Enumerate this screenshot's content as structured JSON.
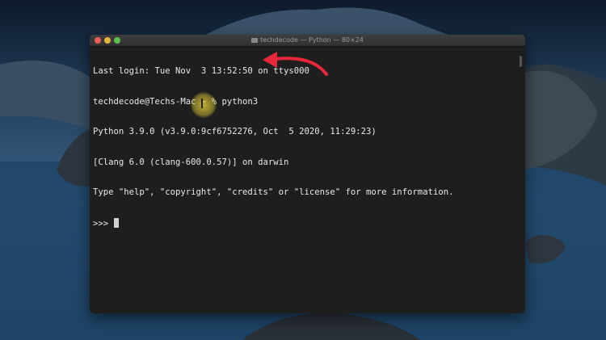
{
  "window": {
    "title": "techdecode — Python — 80×24"
  },
  "terminal": {
    "lines": [
      "Last login: Tue Nov  3 13:52:50 on ttys000",
      "techdecode@Techs-Mac ~ % python3",
      "Python 3.9.0 (v3.9.0:9cf6752276, Oct  5 2020, 11:29:23)",
      "[Clang 6.0 (clang-600.0.57)] on darwin",
      "Type \"help\", \"copyright\", \"credits\" or \"license\" for more information.",
      ">>> "
    ]
  },
  "colors": {
    "terminal_bg": "#1e1e1e",
    "text": "#e8e8e8",
    "annotation_arrow": "#e8283a",
    "pointer_highlight": "#e6d232"
  }
}
